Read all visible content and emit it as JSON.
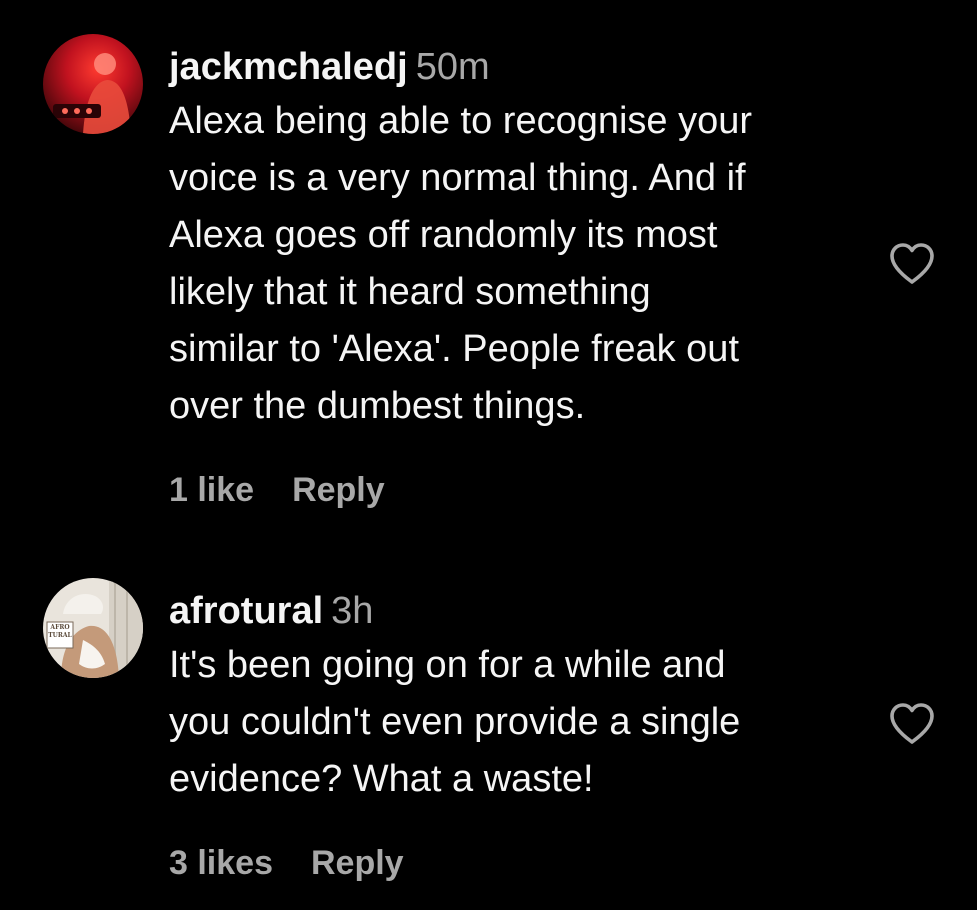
{
  "comments": [
    {
      "username": "jackmchaledj",
      "time": "50m",
      "lines": [
        "Alexa being able to recognise your",
        "voice is a very normal thing. And if",
        "Alexa goes off randomly its most",
        "likely that it heard something",
        "similar to 'Alexa'. People freak out",
        "over the dumbest things."
      ],
      "likes": "1 like",
      "reply_label": "Reply",
      "like_icon": "heart-outline-icon"
    },
    {
      "username": "afrotural",
      "time": "3h",
      "lines": [
        "It's been going on for a while and",
        "you couldn't even provide a single",
        "evidence? What a waste!"
      ],
      "likes": "3 likes",
      "reply_label": "Reply",
      "like_icon": "heart-outline-icon",
      "avatar_text": "AFRO TURAL"
    }
  ],
  "colors": {
    "background": "#000000",
    "primary_text": "#f5f5f5",
    "secondary_text": "#a8a8a8"
  }
}
